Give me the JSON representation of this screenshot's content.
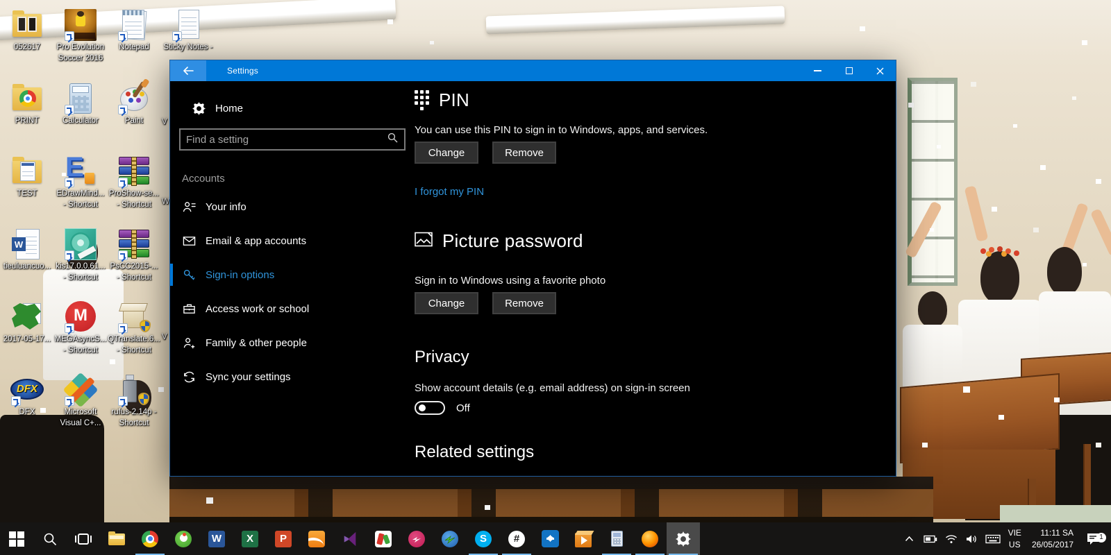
{
  "colors": {
    "accent": "#0078d7",
    "titlebar": "#0078d7",
    "link": "#3094db"
  },
  "desktop": {
    "icons": [
      {
        "label": "052617"
      },
      {
        "label": "Pro Evolution",
        "label2": "Soccer 2016"
      },
      {
        "label": "Notepad"
      },
      {
        "label": "Sticky Notes -"
      },
      {
        "label": "PRINT"
      },
      {
        "label": "Calculator"
      },
      {
        "label": "Paint"
      },
      {
        "label": "TEST"
      },
      {
        "label": "EDrawMind...",
        "label2": "- Shortcut"
      },
      {
        "label": "ProShow-se...",
        "label2": "- Shortcut"
      },
      {
        "label": "tieuluancuo..."
      },
      {
        "label": "kis17.0.0.61...",
        "label2": "- Shortcut"
      },
      {
        "label": "PsCC2015-...",
        "label2": "- Shortcut"
      },
      {
        "label": "2017-05-17..."
      },
      {
        "label": "MEGAsyncS...",
        "label2": "- Shortcut"
      },
      {
        "label": "QTranslate.6...",
        "label2": "- Shortcut"
      },
      {
        "label": "DFX"
      },
      {
        "label": "Microsoft",
        "label2": "Visual C+..."
      },
      {
        "label": "rufus-2.14p -",
        "label2": "Shortcut"
      }
    ],
    "glyphs": {
      "edraw": "E",
      "word_doc": "W",
      "mega": "M",
      "dfx": "DFX"
    },
    "fragments": [
      {
        "text": "V"
      },
      {
        "text": "W"
      },
      {
        "text": "V"
      }
    ]
  },
  "window": {
    "title": "Settings",
    "sidebar": {
      "home": "Home",
      "search_placeholder": "Find a setting",
      "section": "Accounts",
      "items": [
        "Your info",
        "Email & app accounts",
        "Sign-in options",
        "Access work or school",
        "Family & other people",
        "Sync your settings"
      ]
    },
    "content": {
      "pin": {
        "title": "PIN",
        "desc": "You can use this PIN to sign in to Windows, apps, and services.",
        "change": "Change",
        "remove": "Remove",
        "forgot": "I forgot my PIN"
      },
      "picture": {
        "title": "Picture password",
        "desc": "Sign in to Windows using a favorite photo",
        "change": "Change",
        "remove": "Remove"
      },
      "privacy": {
        "title": "Privacy",
        "desc": "Show account details (e.g. email address) on sign-in screen",
        "toggle_state": "Off"
      },
      "related_title": "Related settings"
    }
  },
  "taskbar": {
    "glyphs": {
      "word": "W",
      "excel": "X",
      "powerpoint": "P",
      "skype": "S",
      "hash": "#"
    },
    "tray": {
      "language_primary": "VIE",
      "language_secondary": "US",
      "time": "11:11 SA",
      "date": "26/05/2017",
      "notification_count": "1"
    }
  }
}
